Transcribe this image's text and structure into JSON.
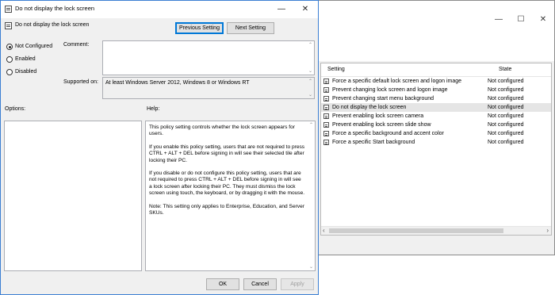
{
  "background_window": {
    "headers": {
      "setting": "Setting",
      "state": "State"
    },
    "rows": [
      {
        "name": "Force a specific default lock screen and logon image",
        "state": "Not configured",
        "selected": false
      },
      {
        "name": "Prevent changing lock screen and logon image",
        "state": "Not configured",
        "selected": false
      },
      {
        "name": "Prevent changing start menu background",
        "state": "Not configured",
        "selected": false
      },
      {
        "name": "Do not display the lock screen",
        "state": "Not configured",
        "selected": true
      },
      {
        "name": "Prevent enabling lock screen camera",
        "state": "Not configured",
        "selected": false
      },
      {
        "name": "Prevent enabling lock screen slide show",
        "state": "Not configured",
        "selected": false
      },
      {
        "name": "Force a specific background and accent color",
        "state": "Not configured",
        "selected": false
      },
      {
        "name": "Force a specific Start background",
        "state": "Not configured",
        "selected": false
      }
    ]
  },
  "dialog": {
    "window_title": "Do not display the lock screen",
    "policy_name": "Do not display the lock screen",
    "prev_button": "Previous Setting",
    "next_button": "Next Setting",
    "radios": {
      "not_configured": "Not Configured",
      "enabled": "Enabled",
      "disabled": "Disabled"
    },
    "selected_radio": "not_configured",
    "comment_label": "Comment:",
    "comment_value": "",
    "supported_label": "Supported on:",
    "supported_value": "At least Windows Server 2012, Windows 8 or Windows RT",
    "options_label": "Options:",
    "help_label": "Help:",
    "help_paragraphs": [
      "This policy setting controls whether the lock screen appears for users.",
      "If you enable this policy setting, users that are not required to press CTRL + ALT + DEL before signing in will see their selected tile after locking their PC.",
      "If you disable or do not configure this policy setting, users that are not required to press CTRL + ALT + DEL before signing in will see a lock screen after locking their PC. They must dismiss the lock screen using touch, the keyboard, or by dragging it with the mouse.",
      "Note: This setting only applies to Enterprise, Education, and Server SKUs."
    ],
    "ok_button": "OK",
    "cancel_button": "Cancel",
    "apply_button": "Apply"
  },
  "colors": {
    "dialog_border": "#3c7fd3",
    "focus_blue": "#0078d7",
    "selected_row": "#e5e5e5"
  }
}
